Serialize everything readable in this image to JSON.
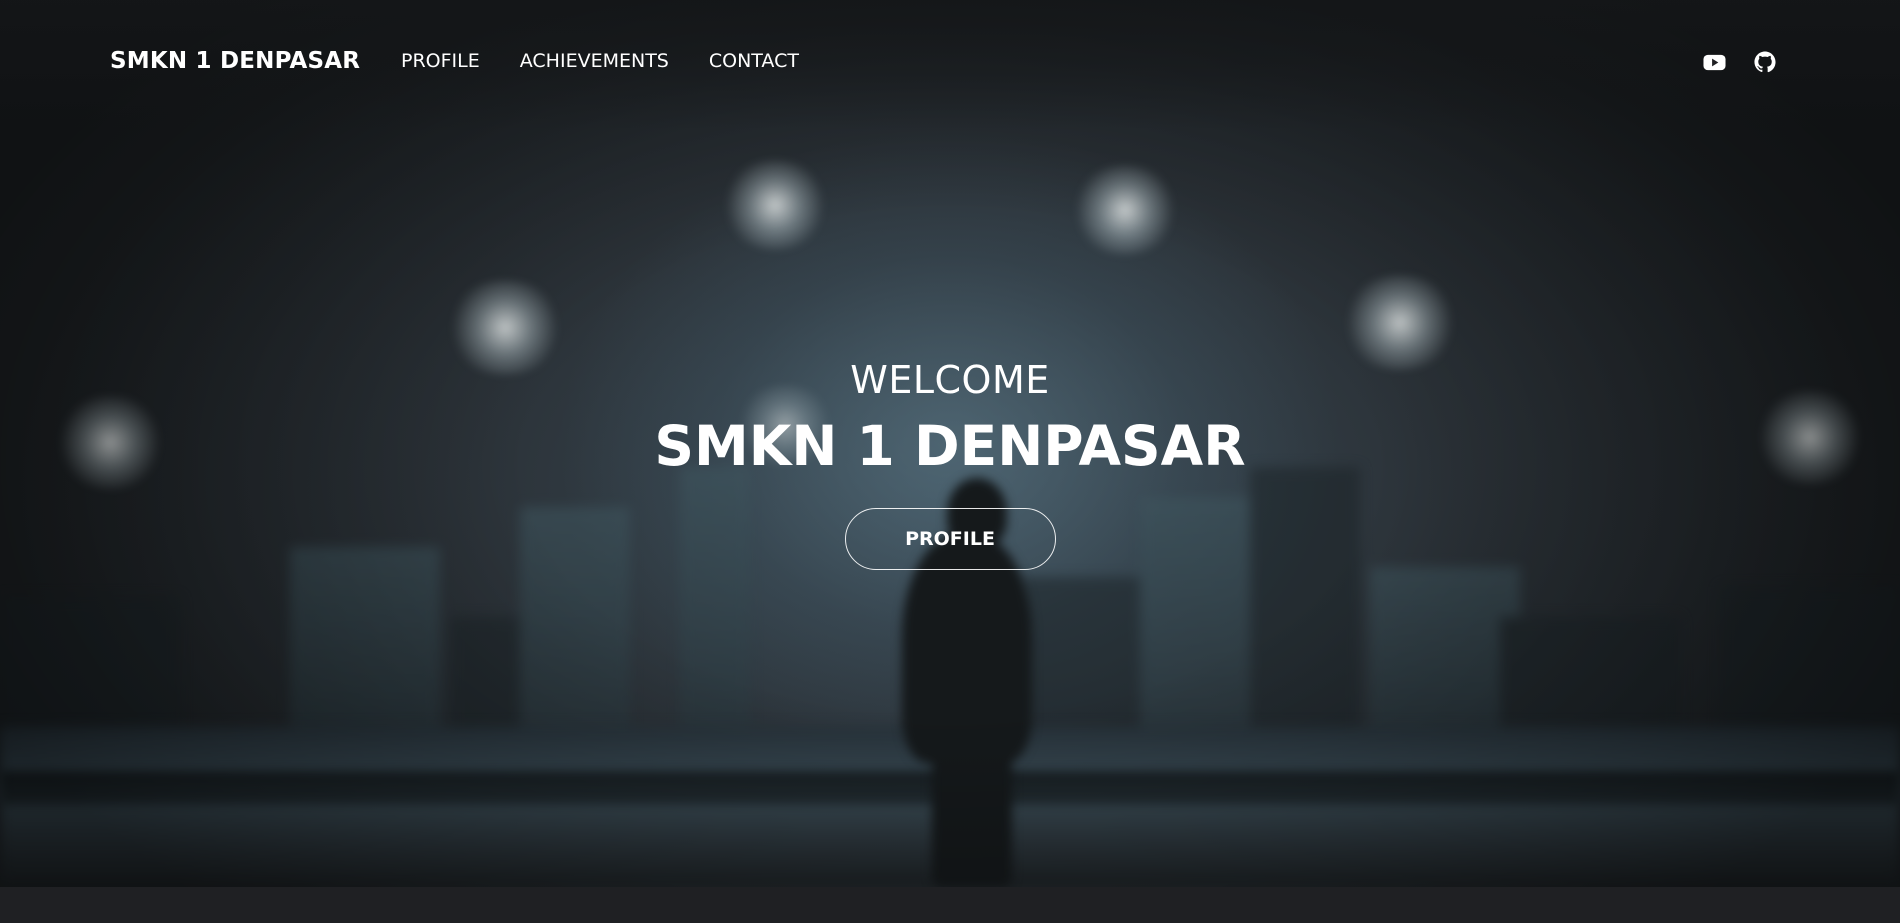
{
  "navbar": {
    "brand": "SMKN 1 DENPASAR",
    "links": [
      {
        "label": "PROFILE"
      },
      {
        "label": "ACHIEVEMENTS"
      },
      {
        "label": "CONTACT"
      }
    ],
    "social": [
      {
        "icon": "youtube-icon"
      },
      {
        "icon": "github-icon"
      }
    ]
  },
  "hero": {
    "welcome": "WELCOME",
    "title": "SMKN 1 DENPASAR",
    "button_label": "PROFILE"
  },
  "colors": {
    "text": "#ffffff",
    "page_background": "#1f2023"
  }
}
